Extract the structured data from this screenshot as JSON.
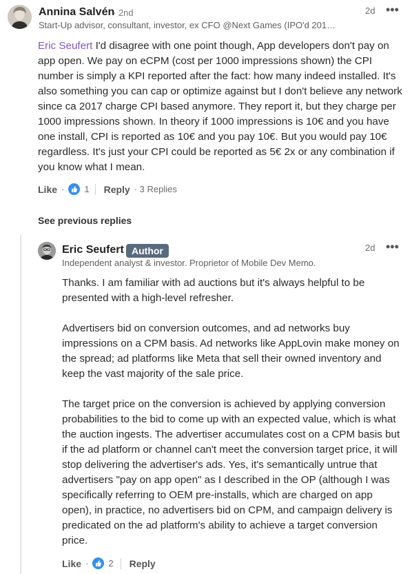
{
  "comment1": {
    "author": "Annina Salvén",
    "degree": "· 2nd",
    "headline": "Start-Up advisor, consultant, investor, ex CFO @Next Games (IPO'd 201…",
    "time": "2d",
    "more_icon": "more-horizontal-icon",
    "mention": "Eric Seufert",
    "text": " I'd disagree with one point though, App developers don't pay on app open. We pay on eCPM (cost per 1000 impressions shown) the CPI number is simply a KPI reported after the fact: how many indeed installed. It's also something you can cap or optimize against but I don't believe any network since ca 2017 charge CPI based anymore. They report it, but they charge per 1000 impressions shown. In theory if 1000 impressions is 10€ and you have one install, CPI is reported as 10€ and you pay 10€. But you would pay 10€ regardless. It's just your CPI could be reported as 5€ 2x or any combination if you know what I mean.",
    "like_label": "Like",
    "reaction_icon": "thumbs-up-reaction-icon",
    "reaction_count": "1",
    "reply_label": "Reply",
    "replies_count": "· 3 Replies"
  },
  "see_previous": "See previous replies",
  "comment2": {
    "author": "Eric Seufert",
    "badge": "Author",
    "headline": "Independent analyst & investor. Proprietor of Mobile Dev Memo.",
    "time": "2d",
    "paragraphs": [
      "Thanks. I am familiar with ad auctions but it's always helpful to be presented with a high-level refresher.",
      "Advertisers bid on conversion outcomes, and ad networks buy impressions on a CPM basis. Ad networks like AppLovin make money on the spread; ad platforms like Meta that sell their owned inventory and keep the vast majority of the sale price.",
      "The target price on the conversion is achieved by applying conversion probabilities to the bid to come up with an expected value, which is what the auction ingests. The advertiser accumulates cost on a CPM basis but if the ad platform or channel can't meet the conversion target price, it will stop delivering the advertiser's ads. Yes, it's semantically untrue that advertisers \"pay on app open\" as I described in the OP (although I was specifically referring to OEM pre-installs, which are charged on app open), in practice, no advertisers bid on CPM, and campaign delivery is predicated on the ad platform's ability to achieve a target conversion price."
    ],
    "like_label": "Like",
    "reaction_count": "2",
    "reply_label": "Reply"
  },
  "colors": {
    "mention": "#7e57c2",
    "badge_bg": "#5a6a7e",
    "like_blue": "#378fe9"
  }
}
